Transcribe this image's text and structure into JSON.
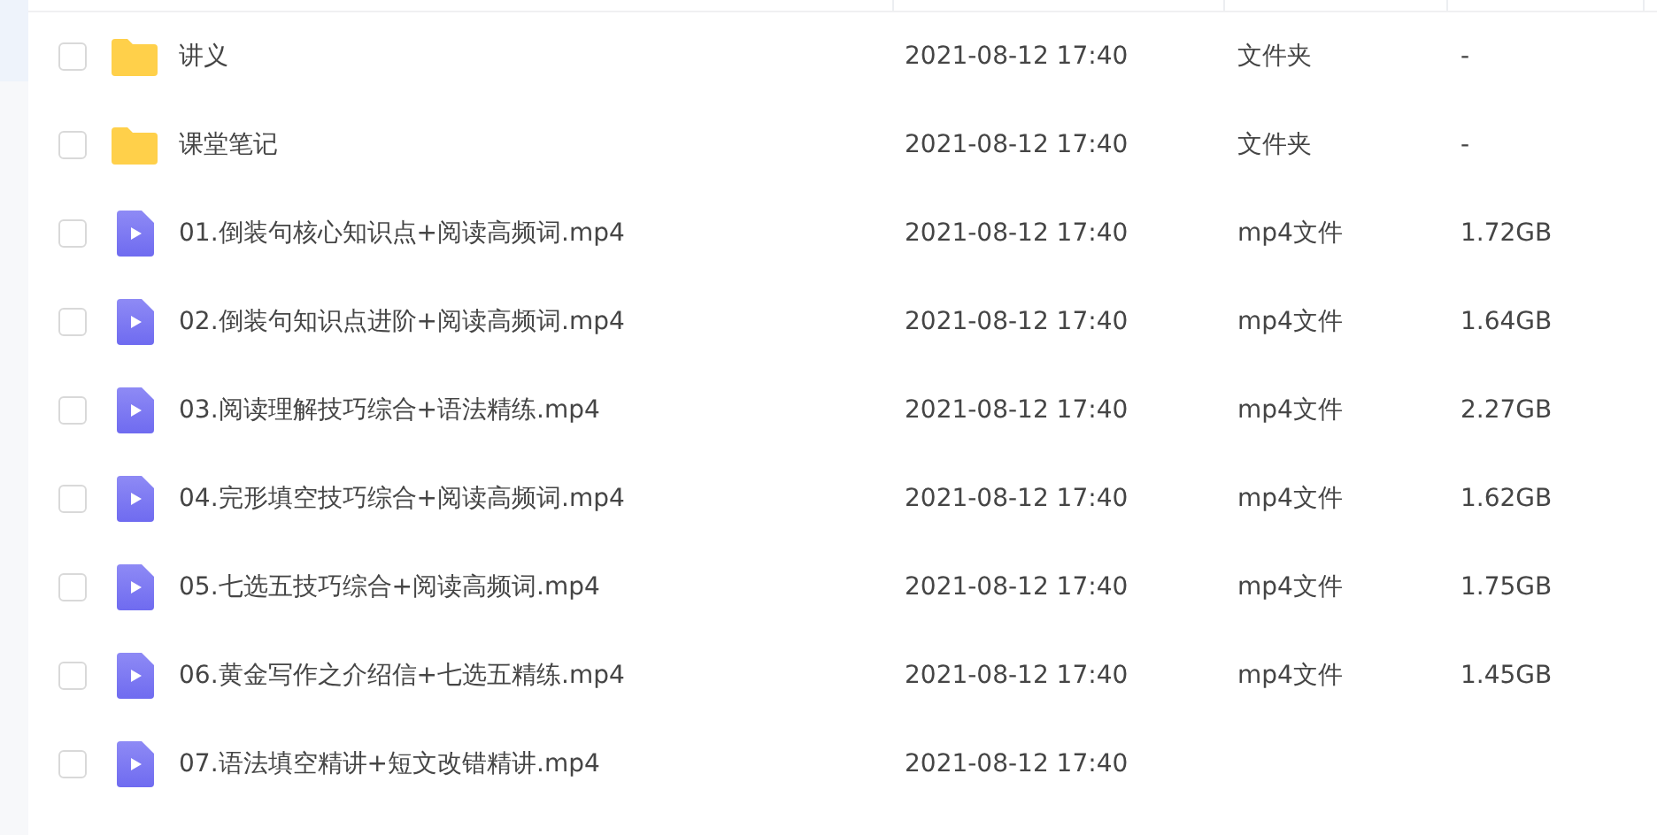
{
  "files": [
    {
      "kind": "folder",
      "name": "讲义",
      "modified": "2021-08-12 17:40",
      "type": "文件夹",
      "size": "-",
      "checked": false
    },
    {
      "kind": "folder",
      "name": "课堂笔记",
      "modified": "2021-08-12 17:40",
      "type": "文件夹",
      "size": "-",
      "checked": false
    },
    {
      "kind": "video",
      "name": "01.倒装句核心知识点+阅读高频词.mp4",
      "modified": "2021-08-12 17:40",
      "type": "mp4文件",
      "size": "1.72GB",
      "checked": false
    },
    {
      "kind": "video",
      "name": "02.倒装句知识点进阶+阅读高频词.mp4",
      "modified": "2021-08-12 17:40",
      "type": "mp4文件",
      "size": "1.64GB",
      "checked": false
    },
    {
      "kind": "video",
      "name": "03.阅读理解技巧综合+语法精练.mp4",
      "modified": "2021-08-12 17:40",
      "type": "mp4文件",
      "size": "2.27GB",
      "checked": false
    },
    {
      "kind": "video",
      "name": "04.完形填空技巧综合+阅读高频词.mp4",
      "modified": "2021-08-12 17:40",
      "type": "mp4文件",
      "size": "1.62GB",
      "checked": false
    },
    {
      "kind": "video",
      "name": "05.七选五技巧综合+阅读高频词.mp4",
      "modified": "2021-08-12 17:40",
      "type": "mp4文件",
      "size": "1.75GB",
      "checked": false
    },
    {
      "kind": "video",
      "name": "06.黄金写作之介绍信+七选五精练.mp4",
      "modified": "2021-08-12 17:40",
      "type": "mp4文件",
      "size": "1.45GB",
      "checked": false
    },
    {
      "kind": "video",
      "name": "07.语法填空精讲+短文改错精讲.mp4",
      "modified": "2021-08-12 17:40",
      "checked": false
    }
  ]
}
